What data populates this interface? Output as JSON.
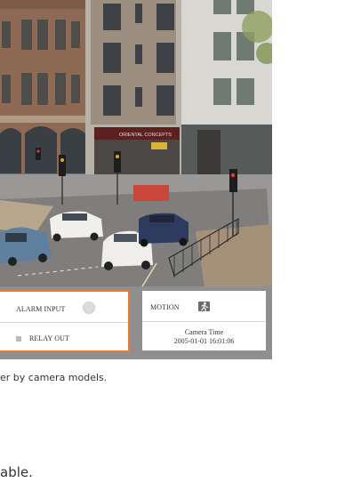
{
  "viewer": {
    "alarm_input_label": "ALARM INPUT",
    "relay_out_label": "RELAY OUT",
    "motion_label": "MOTION",
    "camera_time_label": "Camera Time",
    "camera_time_value": "2005-01-01 16:01:06",
    "highlight_color": "#f07a2a"
  },
  "scene": {
    "shop_sign": "ORIENTAL CONCEPTS"
  },
  "icons": {
    "alarm_indicator": "circle-indicator-icon",
    "relay_indicator": "square-indicator-icon",
    "motion_indicator": "running-person-icon"
  },
  "document": {
    "caption": "er by camera models.",
    "body_line": "able."
  }
}
